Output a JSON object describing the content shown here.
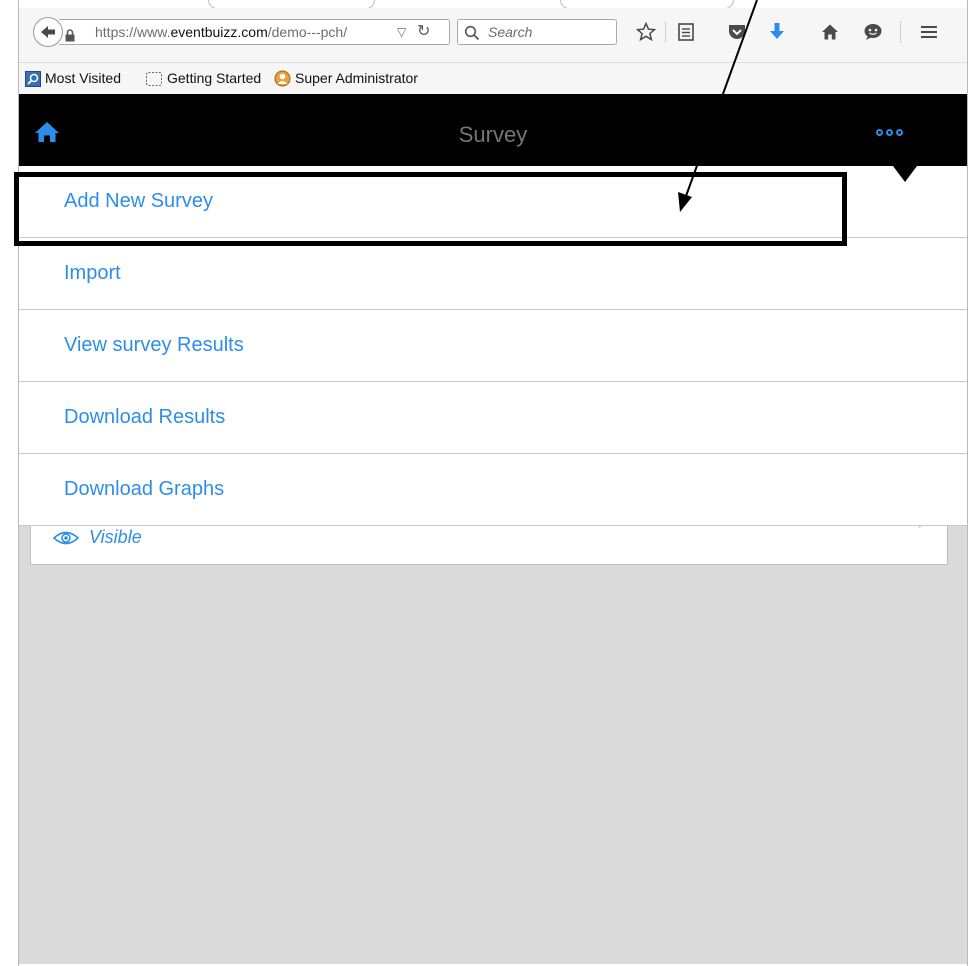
{
  "browser": {
    "url_prefix": "https://www.",
    "url_domain": "eventbuizz.com",
    "url_path": "/demo---pch/",
    "search_placeholder": "Search",
    "bookmarks": [
      {
        "label": "Most Visited"
      },
      {
        "label": "Getting Started"
      },
      {
        "label": "Super Administrator"
      }
    ]
  },
  "app": {
    "title": "Survey",
    "accent_color": "#2d8eea",
    "menu": [
      {
        "label": "Add New Survey"
      },
      {
        "label": "Import"
      },
      {
        "label": "View survey Results"
      },
      {
        "label": "Download Results"
      },
      {
        "label": "Download Graphs"
      }
    ],
    "survey_card": {
      "visibility_label": "Visible"
    }
  }
}
